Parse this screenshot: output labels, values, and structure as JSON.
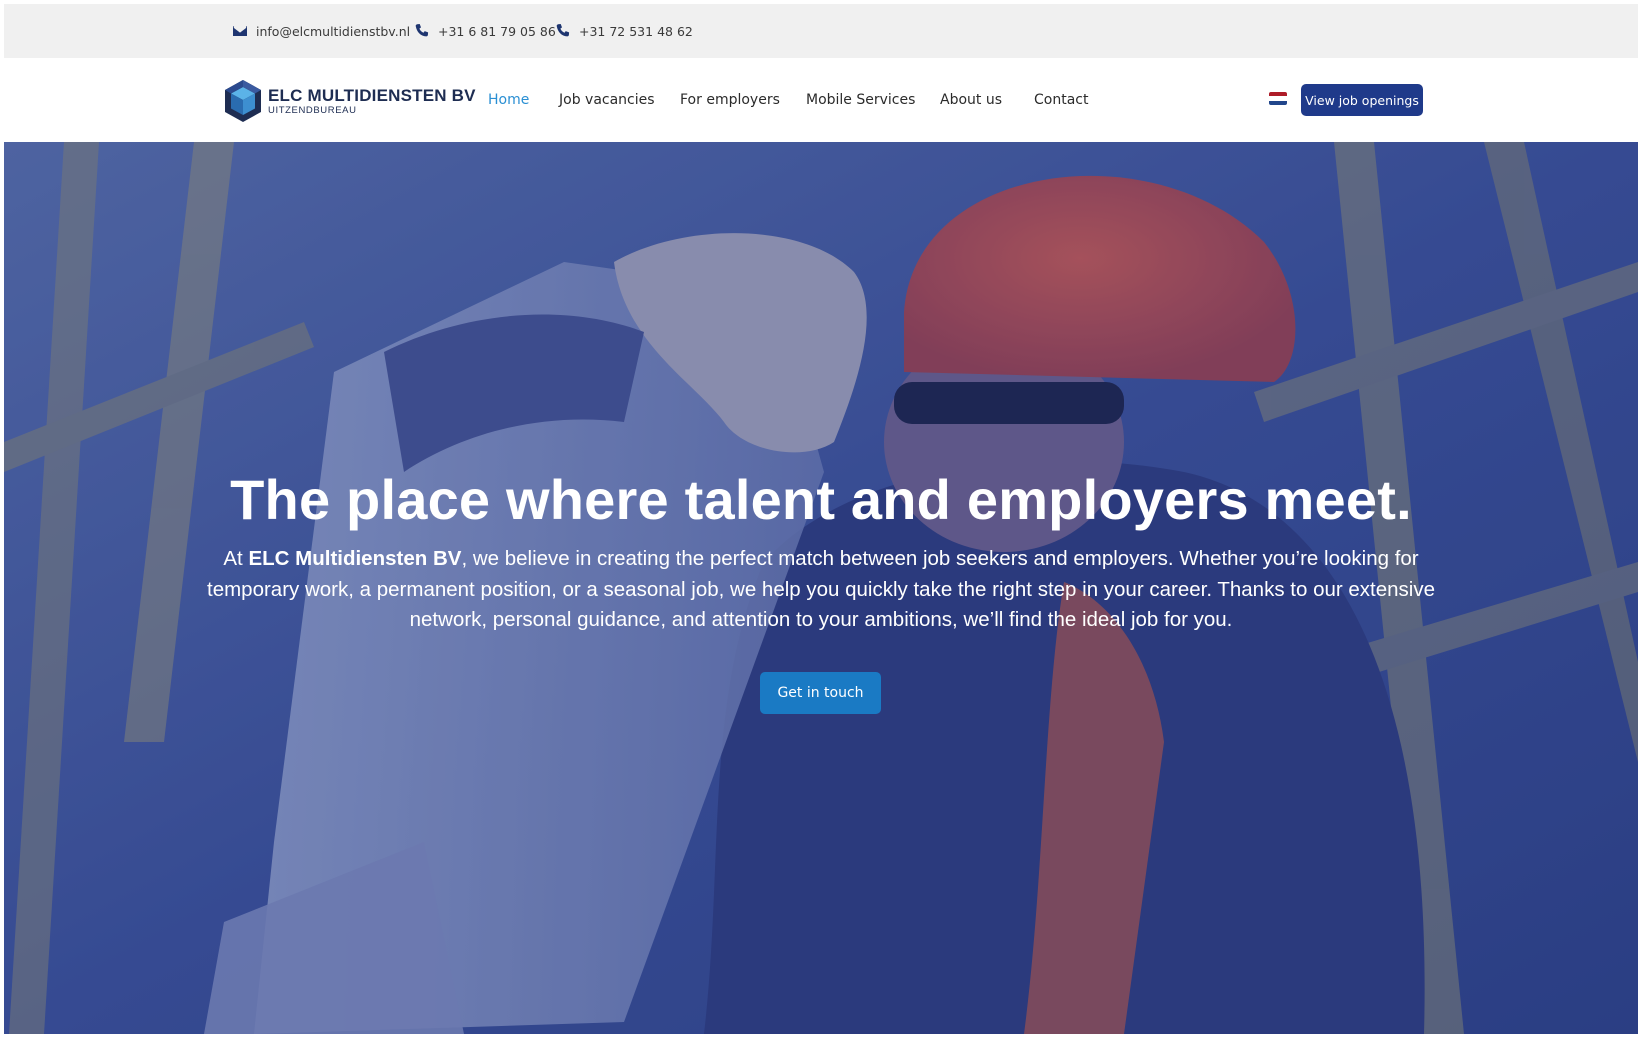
{
  "topbar": {
    "email": "info@elcmultidienstbv.nl",
    "phone1": "+31 6 81 79 05 86",
    "phone2": "+31 72 531 48 62"
  },
  "brand": {
    "name": "ELC MULTIDIENSTEN BV",
    "tagline": "UITZENDBUREAU"
  },
  "nav": {
    "items": [
      "Home",
      "Job vacancies",
      "For employers",
      "Mobile Services",
      "About us",
      "Contact"
    ],
    "active": "Home",
    "language_flag": "netherlands-flag-icon",
    "cta_label": "View job openings"
  },
  "hero": {
    "title": "The place where talent and employers meet.",
    "intro_prefix": "At ",
    "intro_company": "ELC Multidiensten BV",
    "intro_body": ", we believe in creating the perfect match between job seekers and employers. Whether you’re looking for temporary work, a permanent position, or a seasonal job, we help you quickly take the right step in your career. Thanks to our extensive network, personal guidance, and attention to your ambitions, we’ll find the ideal job for you.",
    "cta_label": "Get in touch"
  },
  "colors": {
    "primary_dark": "#1f3a8a",
    "accent_blue": "#1a7ac4",
    "active_link": "#2a8fd3",
    "hero_overlay": "#34478e",
    "topbar_bg": "#f0f0f0"
  }
}
